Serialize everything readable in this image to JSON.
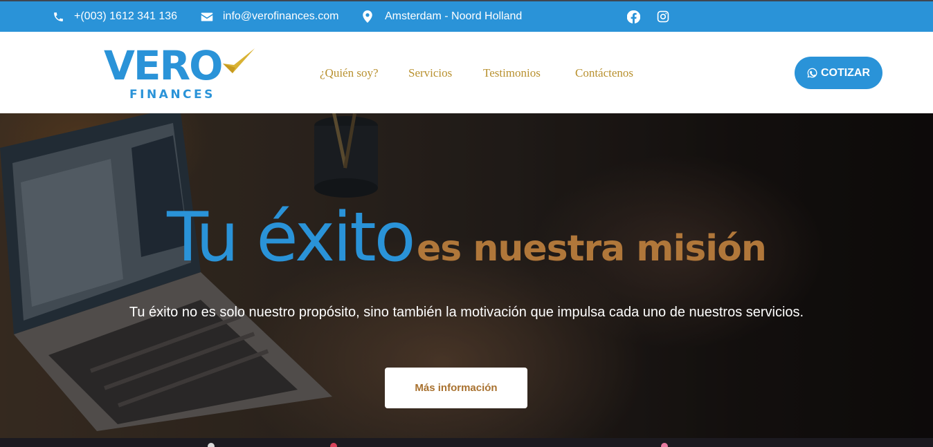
{
  "topbar": {
    "phone": "+(003) 1612 341 136",
    "email": "info@verofinances.com",
    "location": "Amsterdam - Noord Holland",
    "social": [
      "facebook-icon",
      "instagram-icon"
    ]
  },
  "logo": {
    "line1": "VERO",
    "line2": "FINANCES"
  },
  "nav": {
    "items": [
      "¿Quién soy?",
      "Servicios",
      "Testimonios",
      "Contáctenos"
    ]
  },
  "cta": {
    "label": "COTIZAR",
    "icon": "whatsapp-icon"
  },
  "hero": {
    "headline_primary": "Tu éxito",
    "headline_secondary": "es nuestra misión",
    "subtitle": "Tu éxito no es solo nuestro propósito, sino también la motivación que impulsa cada uno de nuestros servicios.",
    "button_label": "Más información"
  },
  "colors": {
    "brand_blue": "#2a93d8",
    "gold": "#b8902e",
    "bronze": "#b0773a"
  }
}
